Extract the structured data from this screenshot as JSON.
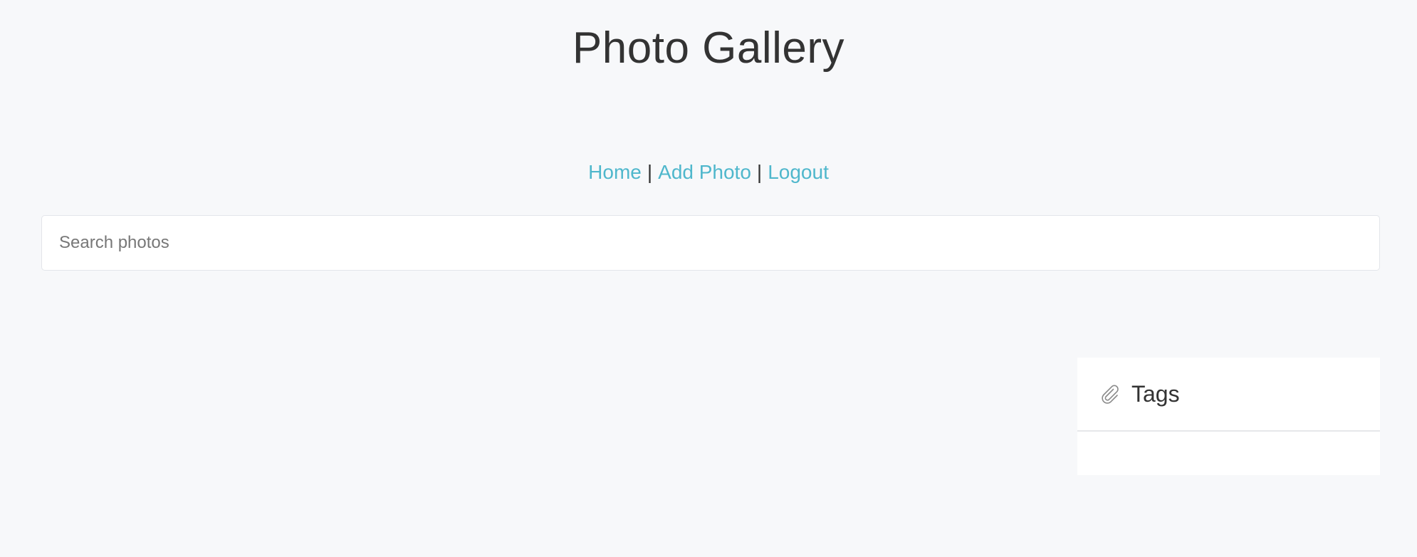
{
  "header": {
    "title": "Photo Gallery"
  },
  "nav": {
    "items": [
      {
        "label": "Home"
      },
      {
        "label": "Add Photo"
      },
      {
        "label": "Logout"
      }
    ],
    "separator": "|"
  },
  "search": {
    "placeholder": "Search photos",
    "value": ""
  },
  "tags_panel": {
    "icon": "paperclip-icon",
    "title": "Tags",
    "items": []
  },
  "colors": {
    "background": "#f7f8fa",
    "link": "#4fb7cc",
    "text": "#333333"
  }
}
